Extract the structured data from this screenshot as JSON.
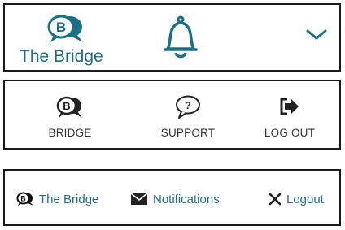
{
  "colors": {
    "accent": "#1d6f86",
    "icon_dark": "#222222",
    "label_gray": "#333333"
  },
  "header_bar": {
    "brand_logo_letter": "B",
    "brand_label": "The Bridge",
    "icons": [
      "bridge-logo-icon",
      "bell-icon",
      "chevron-down-icon"
    ]
  },
  "icon_nav": {
    "items": [
      {
        "icon": "bridge-logo-icon",
        "icon_letter": "B",
        "label": "BRIDGE"
      },
      {
        "icon": "speech-question-icon",
        "icon_letter": "?",
        "label": "SUPPORT"
      },
      {
        "icon": "logout-arrow-icon",
        "label": "LOG OUT"
      }
    ]
  },
  "text_nav": {
    "items": [
      {
        "icon": "bridge-logo-icon",
        "icon_letter": "B",
        "label": "The Bridge"
      },
      {
        "icon": "envelope-icon",
        "label": "Notifications"
      },
      {
        "icon": "close-x-icon",
        "label": "Logout"
      }
    ]
  }
}
